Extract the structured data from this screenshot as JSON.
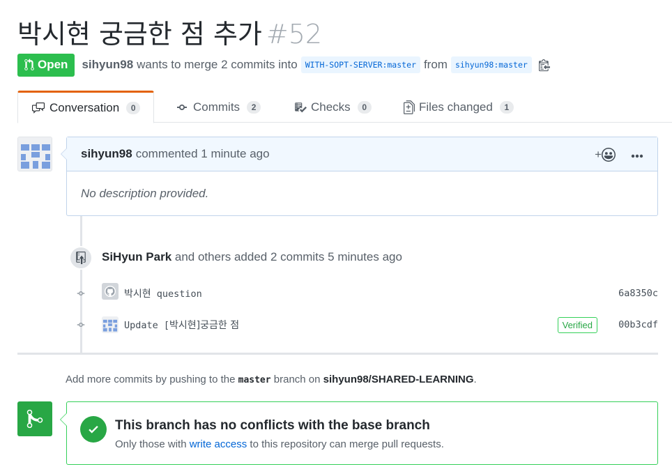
{
  "pr": {
    "title": "박시현 궁금한 점 추가",
    "number": "#52",
    "state": "Open",
    "author": "sihyun98",
    "merge_text": "wants to merge 2 commits into",
    "base_branch": "WITH-SOPT-SERVER:master",
    "from_text": "from",
    "head_branch": "sihyun98:master"
  },
  "tabs": [
    {
      "label": "Conversation",
      "count": "0",
      "icon": "comment-discussion-icon"
    },
    {
      "label": "Commits",
      "count": "2",
      "icon": "git-commit-icon"
    },
    {
      "label": "Checks",
      "count": "0",
      "icon": "checklist-icon"
    },
    {
      "label": "Files changed",
      "count": "1",
      "icon": "diff-icon"
    }
  ],
  "comment": {
    "author": "sihyun98",
    "action": "commented",
    "time": "1 minute ago",
    "body": "No description provided.",
    "reaction_label": "+"
  },
  "push_event": {
    "author": "SiHyun Park",
    "text": "and others added 2 commits",
    "time": "5 minutes ago"
  },
  "commits": [
    {
      "author_kr": "박시현",
      "message": "question",
      "sha": "6a8350c",
      "verified": false
    },
    {
      "prefix": "Update [",
      "kr": "박시현]궁금한 점",
      "sha": "00b3cdf",
      "verified": true,
      "verified_label": "Verified"
    }
  ],
  "hint": {
    "part1": "Add more commits by pushing to the",
    "branch": "master",
    "part2": "branch on",
    "repo": "sihyun98/SHARED-LEARNING",
    "end": "."
  },
  "merge": {
    "title": "This branch has no conflicts with the base branch",
    "sub_part1": "Only those with",
    "link": "write access",
    "sub_part2": "to this repository can merge pull requests."
  },
  "colors": {
    "open_green": "#2cbe4e",
    "success_green": "#28a745",
    "link_blue": "#0366d6",
    "tab_accent": "#e36209"
  }
}
